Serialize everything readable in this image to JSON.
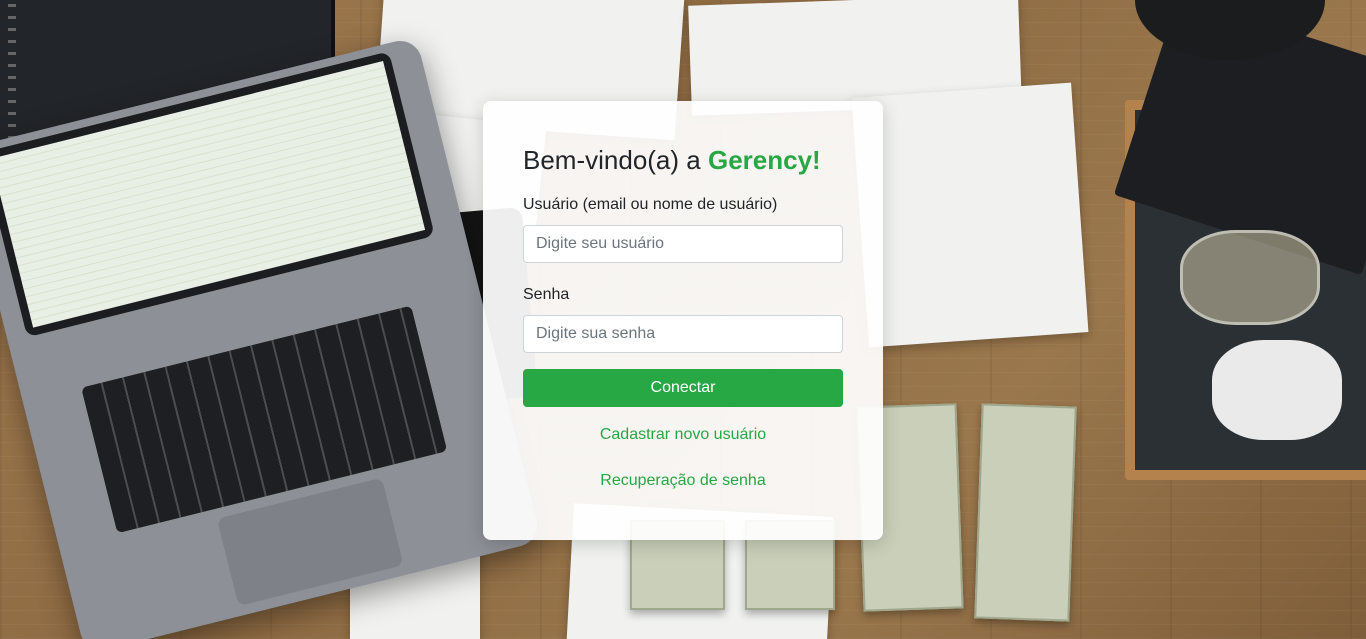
{
  "login": {
    "title_prefix": "Bem-vindo(a) a ",
    "brand": "Gerency!",
    "username": {
      "label": "Usuário (email ou nome de usuário)",
      "placeholder": "Digite seu usuário",
      "value": ""
    },
    "password": {
      "label": "Senha",
      "placeholder": "Digite sua senha",
      "value": ""
    },
    "submit_label": "Conectar",
    "register_link": "Cadastrar novo usuário",
    "recover_link": "Recuperação de senha"
  },
  "colors": {
    "accent": "#28a745",
    "text": "#212529"
  },
  "background": {
    "icon": "desk-photo-background"
  }
}
